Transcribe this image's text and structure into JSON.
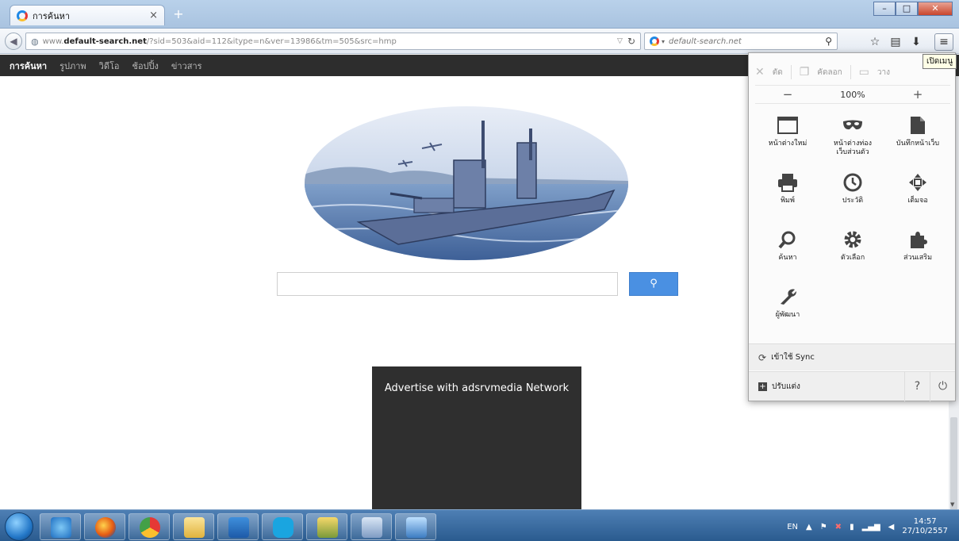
{
  "browser": {
    "tab_title": "การค้นหา",
    "tab_close": "×",
    "new_tab": "+",
    "url_prefix": "www.",
    "url_domain": "default-search.net",
    "url_rest": "/?sid=503&aid=112&itype=n&ver=13986&tm=505&src=hmp",
    "search_placeholder": "default-search.net",
    "menu_tooltip": "เปิดเมนู",
    "window_buttons": {
      "minimize": "–",
      "maximize": "□",
      "close": "✕"
    }
  },
  "site": {
    "nav": [
      {
        "label": "การค้นหา",
        "active": true
      },
      {
        "label": "รูปภาพ",
        "active": false
      },
      {
        "label": "วิดีโอ",
        "active": false
      },
      {
        "label": "ช้อปปิ้ง",
        "active": false
      },
      {
        "label": "ข่าวสาร",
        "active": false
      }
    ],
    "search_button": "⚲",
    "ad_text": "Advertise with adsrvmedia Network"
  },
  "menu_panel": {
    "cut": "ตัด",
    "copy": "คัดลอก",
    "paste": "วาง",
    "zoom_out": "−",
    "zoom_level": "100%",
    "zoom_in": "+",
    "items": [
      {
        "label": "หน้าต่างใหม่",
        "icon": "window-icon"
      },
      {
        "label": "หน้าต่างท่อง\nเว็บส่วนตัว",
        "icon": "private-mask-icon"
      },
      {
        "label": "บันทึกหน้าเว็บ",
        "icon": "save-page-icon"
      },
      {
        "label": "พิมพ์",
        "icon": "print-icon"
      },
      {
        "label": "ประวัติ",
        "icon": "history-icon"
      },
      {
        "label": "เต็มจอ",
        "icon": "fullscreen-icon"
      },
      {
        "label": "ค้นหา",
        "icon": "find-icon"
      },
      {
        "label": "ตัวเลือก",
        "icon": "options-gear-icon"
      },
      {
        "label": "ส่วนเสริม",
        "icon": "addons-puzzle-icon"
      },
      {
        "label": "ผู้พัฒนา",
        "icon": "developer-wrench-icon"
      }
    ],
    "sync_label": "เข้าใช้ Sync",
    "customize_label": "ปรับแต่ง"
  },
  "taskbar": {
    "language": "EN",
    "time": "14:57",
    "date": "27/10/2557"
  }
}
